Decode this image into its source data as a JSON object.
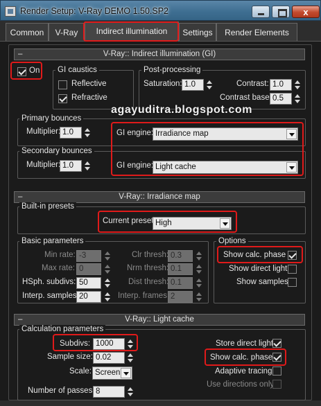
{
  "window": {
    "title": "Render Setup: V-Ray DEMO 1.50.SP2",
    "close_glyph": "x"
  },
  "tabs": [
    {
      "label": "Common"
    },
    {
      "label": "V-Ray"
    },
    {
      "label": "Indirect illumination"
    },
    {
      "label": "Settings"
    },
    {
      "label": "Render Elements"
    }
  ],
  "gi_rollout": {
    "minus": "–",
    "title": "V-Ray:: Indirect illumination (GI)",
    "on_label": "On",
    "caustics": {
      "title": "GI caustics",
      "reflective": "Reflective",
      "refractive": "Refractive"
    },
    "post": {
      "title": "Post-processing",
      "saturation_label": "Saturation:",
      "saturation": "1.0",
      "contrast_label": "Contrast:",
      "contrast": "1.0",
      "contrast_base_label": "Contrast base:",
      "contrast_base": "0.5"
    },
    "primary": {
      "title": "Primary bounces",
      "multiplier_label": "Multiplier:",
      "multiplier": "1.0",
      "engine_label": "GI engine:",
      "engine": "Irradiance map"
    },
    "secondary": {
      "title": "Secondary bounces",
      "multiplier_label": "Multiplier:",
      "multiplier": "1.0",
      "engine_label": "GI engine:",
      "engine": "Light cache"
    }
  },
  "watermark": "agayuditra.blogspot.com",
  "irr_rollout": {
    "minus": "–",
    "title": "V-Ray:: Irradiance map",
    "presets": {
      "title": "Built-in presets",
      "current_label": "Current preset:",
      "current": "High"
    },
    "basic": {
      "title": "Basic parameters",
      "min_rate_label": "Min rate:",
      "min_rate": "-3",
      "max_rate_label": "Max rate:",
      "max_rate": "0",
      "hsph_label": "HSph. subdivs:",
      "hsph": "50",
      "interp_label": "Interp. samples:",
      "interp": "20",
      "clr_label": "Clr thresh:",
      "clr": "0.3",
      "nrm_label": "Nrm thresh:",
      "nrm": "0.1",
      "dist_label": "Dist thresh:",
      "dist": "0.1",
      "frames_label": "Interp. frames:",
      "frames": "2"
    },
    "options": {
      "title": "Options",
      "show_calc": "Show calc. phase",
      "show_direct": "Show direct light",
      "show_samples": "Show samples"
    }
  },
  "lc_rollout": {
    "minus": "–",
    "title": "V-Ray:: Light cache",
    "calc": {
      "title": "Calculation parameters",
      "subdivs_label": "Subdivs:",
      "subdivs": "1000",
      "sample_size_label": "Sample size:",
      "sample_size": "0.02",
      "scale_label": "Scale:",
      "scale": "Screen",
      "passes_label": "Number of passes:",
      "passes": "8",
      "store_direct": "Store direct light",
      "show_calc": "Show calc. phase",
      "adaptive": "Adaptive tracing",
      "use_dirs": "Use directions only"
    }
  }
}
